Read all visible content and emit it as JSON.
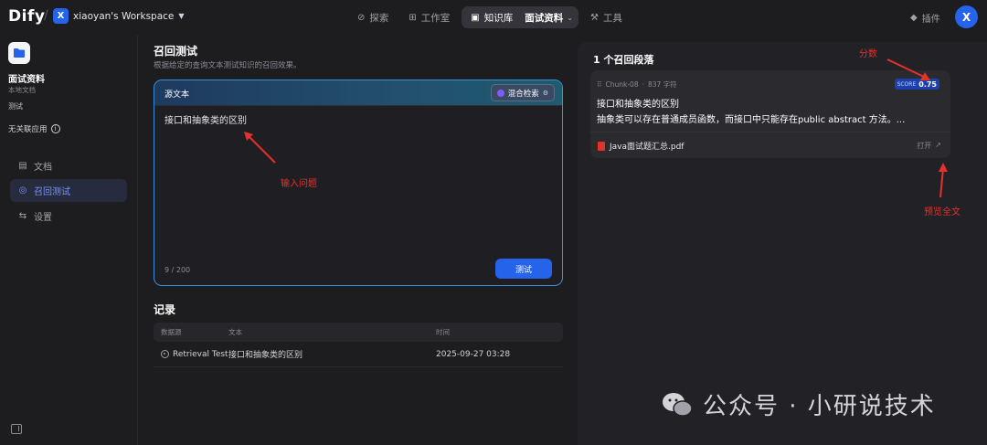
{
  "header": {
    "logo": "Dify",
    "workspace_initial": "X",
    "workspace_name": "xiaoyan's Workspace",
    "nav": {
      "explore": "探索",
      "studio": "工作室",
      "knowledge": "知识库",
      "knowledge_current": "面试资料",
      "tools": "工具"
    },
    "plugins": "插件",
    "user_initial": "X"
  },
  "sidebar": {
    "dataset_name": "面试资料",
    "dataset_type": "本地文档",
    "dataset_desc": "测试",
    "no_linked_apps": "无关联应用",
    "items": [
      {
        "label": "文档"
      },
      {
        "label": "召回测试"
      },
      {
        "label": "设置"
      }
    ]
  },
  "retrieval": {
    "title": "召回测试",
    "subtitle": "根据给定的查询文本测试知识的召回效果。",
    "source_text_label": "源文本",
    "hybrid_search": "混合检索",
    "query_value": "接口和抽象类的区别",
    "char_count": "9 / 200",
    "test_button": "测试"
  },
  "records": {
    "title": "记录",
    "columns": [
      "数据源",
      "文本",
      "时间"
    ],
    "rows": [
      {
        "source": "Retrieval Test",
        "text": "接口和抽象类的区别",
        "time": "2025-09-27 03:28"
      }
    ]
  },
  "results": {
    "title": "1 个召回段落",
    "chunk": {
      "id": "Chunk-08",
      "chars": "837 字符",
      "score_label": "SCORE",
      "score": "0.75",
      "line1": "接口和抽象类的区别",
      "line2": "抽象类可以存在普通成员函数，而接口中只能存在public abstract 方法。...",
      "file": "Java面试题汇总.pdf",
      "open": "打开"
    }
  },
  "annotations": {
    "score": "分数",
    "input_question": "输入问题",
    "preview_full": "预览全文"
  },
  "watermark": "公众号 · 小研说技术",
  "colors": {
    "accent": "#2563eb",
    "annotation": "#e5312c",
    "background": "#1d1d20"
  }
}
